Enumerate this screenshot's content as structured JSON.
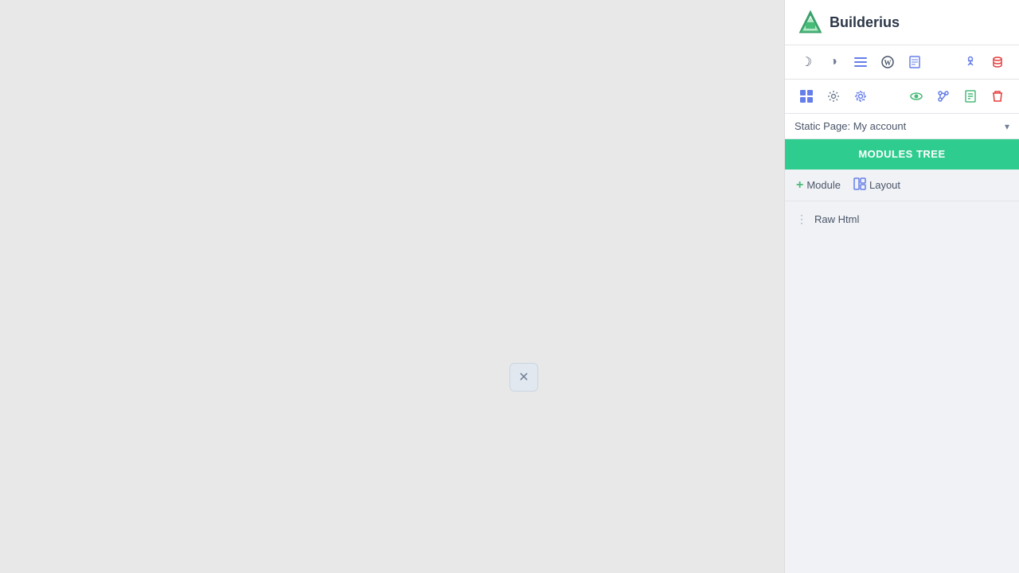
{
  "app": {
    "name": "Builderius"
  },
  "sidebar": {
    "toolbar_row1": {
      "icons": [
        {
          "name": "moon",
          "symbol": "☽",
          "color": "icon-moon"
        },
        {
          "name": "contrast",
          "symbol": "◑",
          "color": "icon-contrast"
        },
        {
          "name": "menu-list",
          "symbol": "≡",
          "color": "icon-menu"
        },
        {
          "name": "wordpress",
          "symbol": "Ⓦ",
          "color": "icon-wp"
        },
        {
          "name": "document",
          "symbol": "▤",
          "color": "icon-doc"
        }
      ],
      "right_icons": [
        {
          "name": "puppet",
          "symbol": "♟",
          "color": "icon-puppet"
        },
        {
          "name": "database",
          "symbol": "⊟",
          "color": "icon-db"
        }
      ]
    },
    "toolbar_row2": {
      "icons": [
        {
          "name": "grid",
          "symbol": "⊞",
          "color": "icon-grid"
        },
        {
          "name": "settings",
          "symbol": "⚙",
          "color": "icon-gear"
        },
        {
          "name": "settings2",
          "symbol": "⚙",
          "color": "icon-gear2"
        }
      ],
      "right_icons": [
        {
          "name": "eye",
          "symbol": "👁",
          "color": "icon-eye"
        },
        {
          "name": "git",
          "symbol": "⎇",
          "color": "icon-git"
        },
        {
          "name": "book",
          "symbol": "📗",
          "color": "icon-book"
        },
        {
          "name": "trash",
          "symbol": "🗑",
          "color": "icon-trash"
        }
      ]
    },
    "page_selector": {
      "label": "Static Page: My account",
      "chevron": "▾"
    },
    "modules_tree": {
      "title": "MODULES TREE",
      "add_module_label": "Module",
      "add_layout_label": "Layout",
      "items": [
        {
          "id": "raw-html",
          "label": "Raw Html",
          "dots": "⋮"
        }
      ]
    }
  },
  "close_btn": {
    "symbol": "✕"
  }
}
